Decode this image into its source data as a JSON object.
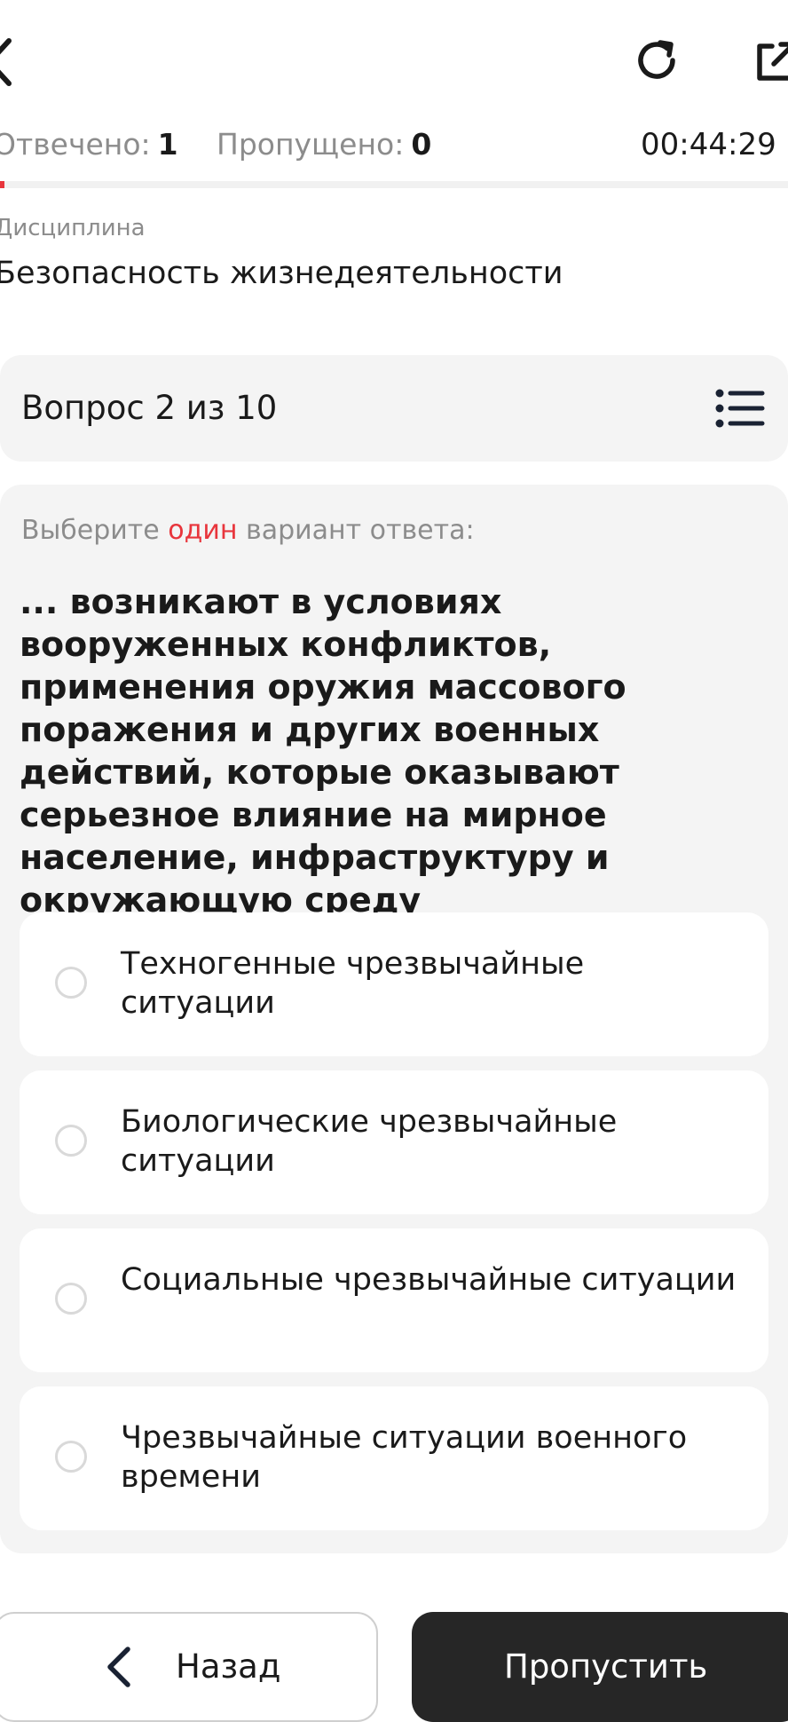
{
  "header": {
    "icons": {
      "back": "chevron-left-icon",
      "refresh": "refresh-icon",
      "share": "open-external-icon"
    }
  },
  "stats": {
    "answered_label": "Отвечено:",
    "answered_value": "1",
    "skipped_label": "Пропущено:",
    "skipped_value": "0",
    "timer": "00:44:29"
  },
  "progress": {
    "answered": 1,
    "total": 10
  },
  "discipline": {
    "label": "Дисциплина",
    "value": "Безопасность жизнедеятельности"
  },
  "question_header": {
    "title": "Вопрос 2 из 10"
  },
  "question": {
    "instruction_prefix": "Выберите",
    "instruction_accent": "один",
    "instruction_suffix": "вариант ответа:",
    "text": "... возникают в условиях вооруженных конфликтов, применения оружия массового поражения и других военных действий, которые оказывают серьезное влияние на мирное население, инфраструктуру и окружающую среду",
    "options": [
      {
        "label": "Техногенные чрезвычайные ситуации",
        "selected": false
      },
      {
        "label": "Биологические чрезвычайные ситуации",
        "selected": false
      },
      {
        "label": "Социальные чрезвычайные ситуации",
        "selected": false
      },
      {
        "label": "Чрезвычайные ситуации военного времени",
        "selected": false
      }
    ]
  },
  "footer": {
    "back_label": "Назад",
    "skip_label": "Пропустить"
  },
  "colors": {
    "accent": "#e8353c",
    "card_bg": "#f4f4f4",
    "primary_button": "#262626",
    "muted_text": "#8c8c8c"
  }
}
